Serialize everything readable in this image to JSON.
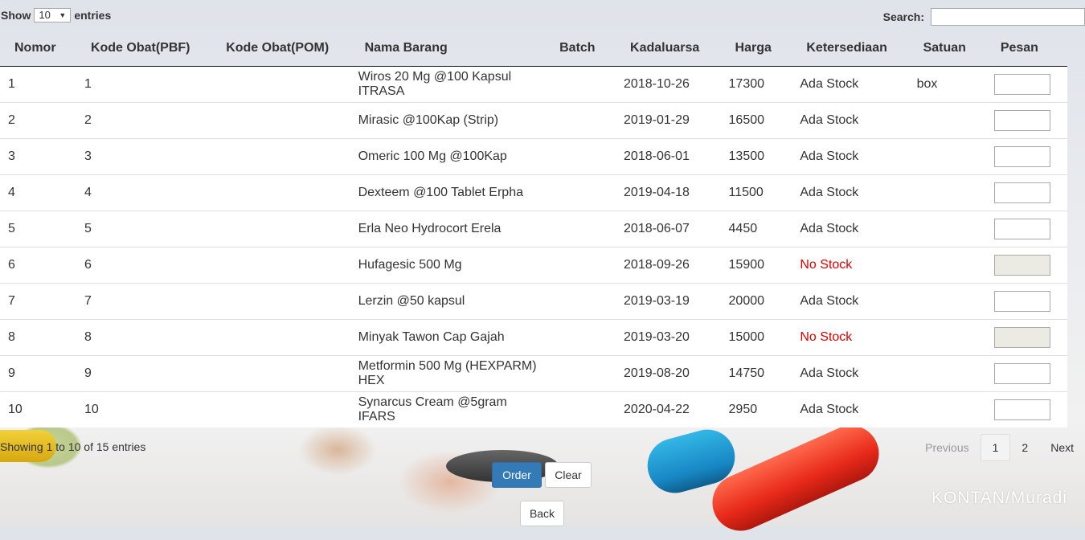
{
  "length_menu": {
    "prefix": "Show",
    "value": "10",
    "suffix": "entries"
  },
  "search": {
    "label": "Search:",
    "value": ""
  },
  "table": {
    "headers": [
      "Nomor",
      "Kode Obat(PBF)",
      "Kode Obat(POM)",
      "Nama Barang",
      "Batch",
      "Kadaluarsa",
      "Harga",
      "Ketersediaan",
      "Satuan",
      "Pesan"
    ],
    "rows": [
      [
        "1",
        "1",
        "",
        "Wiros 20 Mg @100 Kapsul ITRASA",
        "",
        "2018-10-26",
        "17300",
        "Ada Stock",
        "box"
      ],
      [
        "2",
        "2",
        "",
        "Mirasic @100Kap (Strip)",
        "",
        "2019-01-29",
        "16500",
        "Ada Stock",
        ""
      ],
      [
        "3",
        "3",
        "",
        "Omeric 100 Mg @100Kap",
        "",
        "2018-06-01",
        "13500",
        "Ada Stock",
        ""
      ],
      [
        "4",
        "4",
        "",
        "Dexteem @100 Tablet Erpha",
        "",
        "2019-04-18",
        "11500",
        "Ada Stock",
        ""
      ],
      [
        "5",
        "5",
        "",
        "Erla Neo Hydrocort Erela",
        "",
        "2018-06-07",
        "4450",
        "Ada Stock",
        ""
      ],
      [
        "6",
        "6",
        "",
        "Hufagesic 500 Mg",
        "",
        "2018-09-26",
        "15900",
        "No Stock",
        ""
      ],
      [
        "7",
        "7",
        "",
        "Lerzin @50 kapsul",
        "",
        "2019-03-19",
        "20000",
        "Ada Stock",
        ""
      ],
      [
        "8",
        "8",
        "",
        "Minyak Tawon Cap Gajah",
        "",
        "2019-03-20",
        "15000",
        "No Stock",
        ""
      ],
      [
        "9",
        "9",
        "",
        "Metformin 500 Mg (HEXPARM) HEX",
        "",
        "2019-08-20",
        "14750",
        "Ada Stock",
        ""
      ],
      [
        "10",
        "10",
        "",
        "Synarcus Cream @5gram IFARS",
        "",
        "2020-04-22",
        "2950",
        "Ada Stock",
        ""
      ]
    ]
  },
  "info": "Showing 1 to 10 of 15 entries",
  "pagination": {
    "previous": "Previous",
    "pages": [
      "1",
      "2"
    ],
    "current": "1",
    "next": "Next"
  },
  "buttons": {
    "order": "Order",
    "clear": "Clear",
    "back": "Back"
  },
  "watermark": "KONTAN/Muradi",
  "colors": {
    "primary": "#337ab7",
    "no_stock": "#e00000"
  }
}
